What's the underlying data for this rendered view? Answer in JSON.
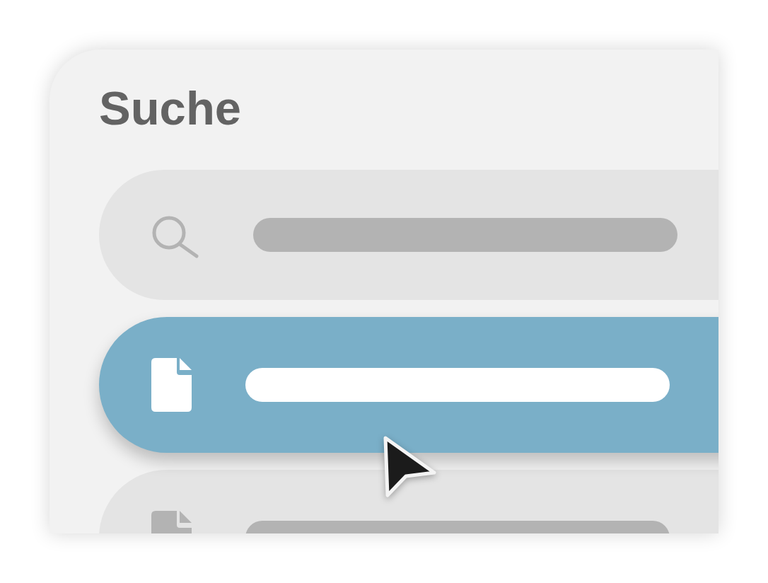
{
  "panel": {
    "title": "Suche"
  },
  "results": [
    {
      "selected": true
    },
    {
      "selected": false
    }
  ]
}
